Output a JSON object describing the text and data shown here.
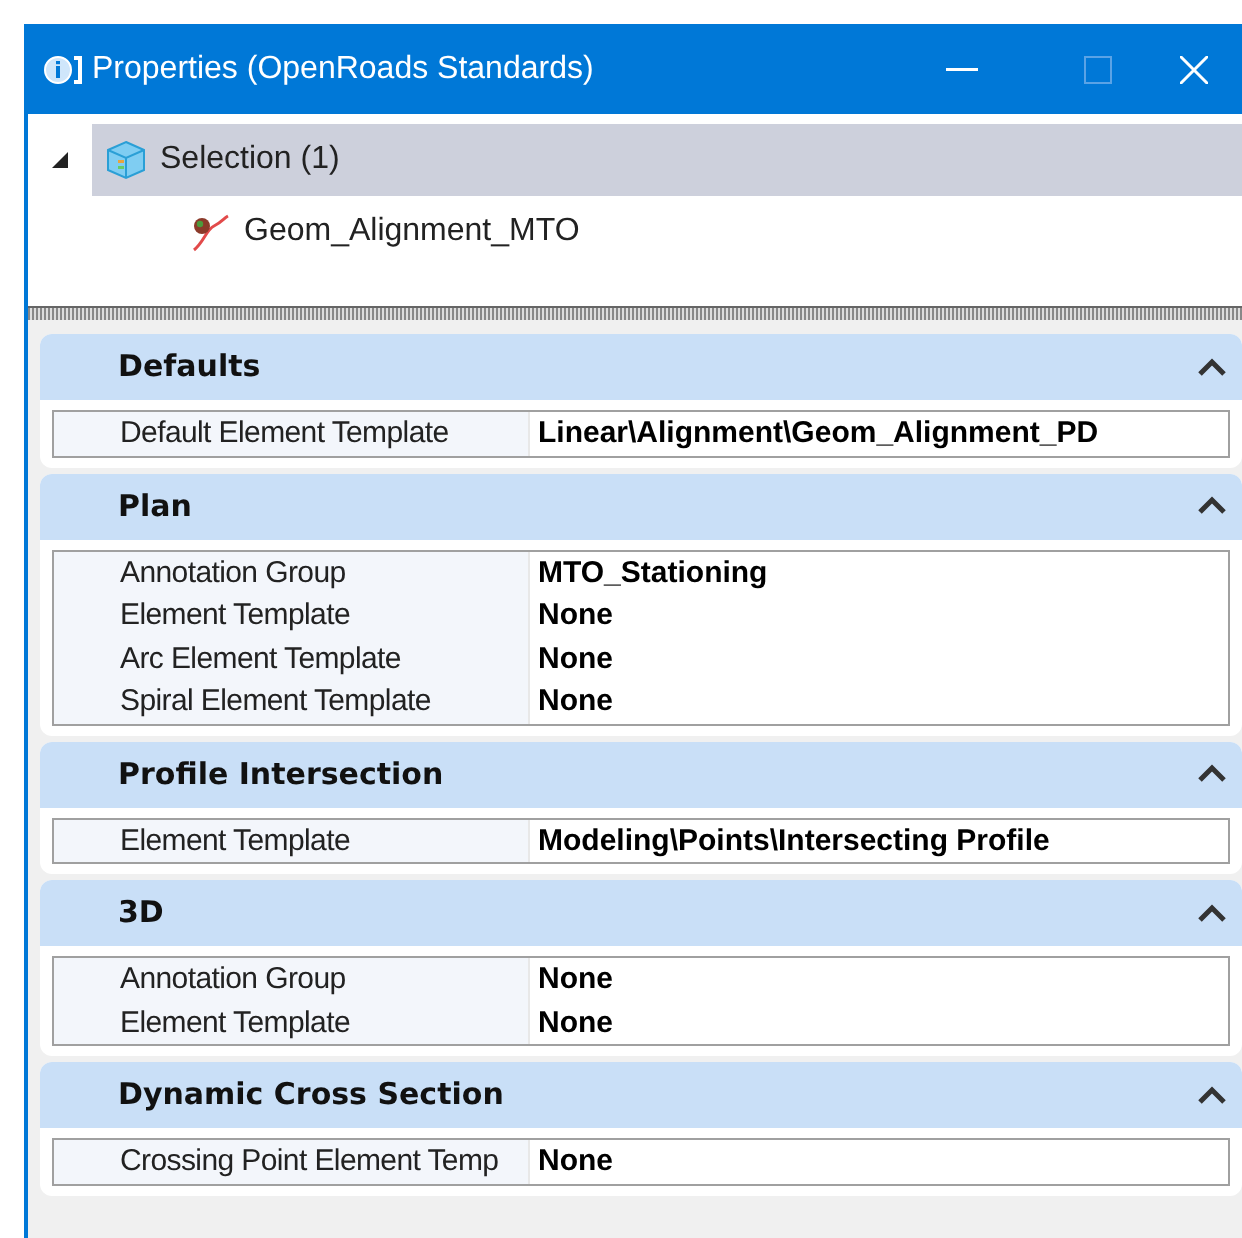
{
  "window": {
    "title": "Properties (OpenRoads Standards)"
  },
  "tree": [
    {
      "label": "Selection (1)",
      "expanded": true,
      "selected": true,
      "children": [
        {
          "label": "Geom_Alignment_MTO",
          "selected": false
        }
      ]
    }
  ],
  "sections": [
    {
      "title": "Defaults",
      "expanded": true,
      "rows": [
        {
          "label": "Default Element Template",
          "value": "Linear\\Alignment\\Geom_Alignment_PD"
        }
      ]
    },
    {
      "title": "Plan",
      "expanded": true,
      "rows": [
        {
          "label": "Annotation Group",
          "value": "MTO_Stationing"
        },
        {
          "label": "Element Template",
          "value": "None"
        },
        {
          "label": "Arc Element Template",
          "value": "None"
        },
        {
          "label": "Spiral Element Template",
          "value": "None"
        }
      ]
    },
    {
      "title": "Profile Intersection",
      "expanded": true,
      "rows": [
        {
          "label": "Element Template",
          "value": "Modeling\\Points\\Intersecting Profile"
        }
      ]
    },
    {
      "title": "3D",
      "expanded": true,
      "rows": [
        {
          "label": "Annotation Group",
          "value": "None"
        },
        {
          "label": "Element Template",
          "value": "None"
        }
      ]
    },
    {
      "title": "Dynamic Cross Section",
      "expanded": true,
      "rows": [
        {
          "label": "Crossing Point Element Temp",
          "value": "None"
        }
      ]
    }
  ]
}
